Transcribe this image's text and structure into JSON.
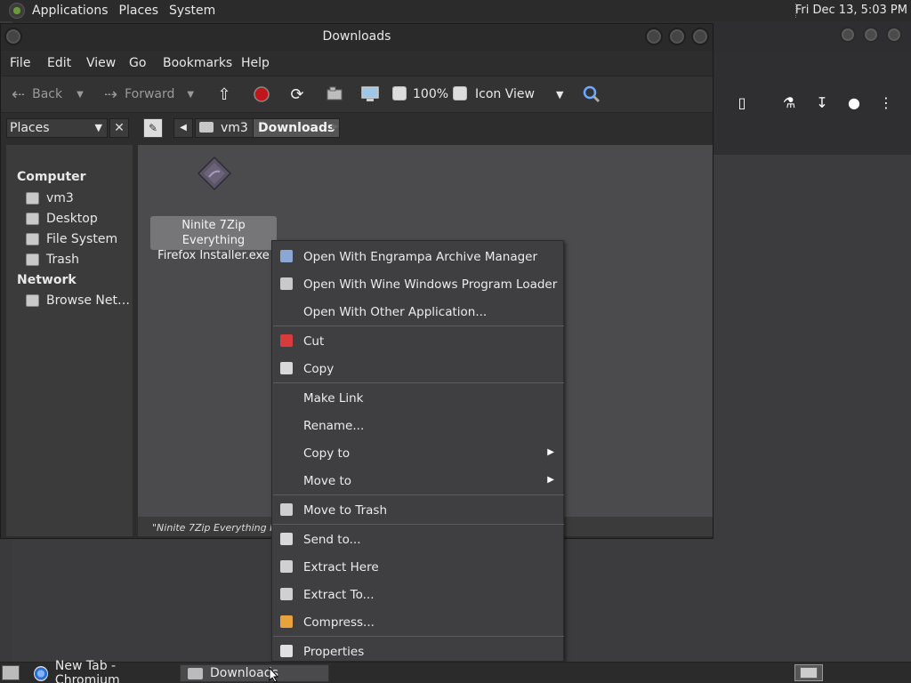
{
  "top_panel": {
    "menus": [
      "Applications",
      "Places",
      "System"
    ],
    "clock": "Fri Dec 13,  5:03 PM"
  },
  "window": {
    "title": "Downloads",
    "menubar": [
      "File",
      "Edit",
      "View",
      "Go",
      "Bookmarks",
      "Help"
    ]
  },
  "toolbar": {
    "back_label": "Back",
    "forward_label": "Forward",
    "zoom": "100%",
    "view_mode": "Icon View"
  },
  "location": {
    "sidebar_select": "Places",
    "crumbs": [
      "vm3",
      "Downloads"
    ]
  },
  "sidebar": {
    "sections": [
      {
        "title": "Computer",
        "items": [
          {
            "label": "vm3",
            "icon": "home-folder-icon"
          },
          {
            "label": "Desktop",
            "icon": "desktop-folder-icon"
          },
          {
            "label": "File System",
            "icon": "drive-icon"
          },
          {
            "label": "Trash",
            "icon": "trash-icon"
          }
        ]
      },
      {
        "title": "Network",
        "items": [
          {
            "label": "Browse Net…",
            "icon": "network-icon"
          }
        ]
      }
    ]
  },
  "file": {
    "label_line1": "Ninite 7Zip Everything",
    "label_line2": "Firefox Installer.exe",
    "icon": "wine-diamond-icon"
  },
  "status_text": "\"Ninite 7Zip Everything Firefox Installer.exe\" selected",
  "context_menu": {
    "groups": [
      [
        {
          "label": "Open With Engrampa Archive Manager",
          "icon": "archive-manager-icon"
        },
        {
          "label": "Open With Wine Windows Program Loader",
          "icon": "wine-icon"
        },
        {
          "label": "Open With Other Application...",
          "icon": ""
        }
      ],
      [
        {
          "label": "Cut",
          "icon": "scissors-icon"
        },
        {
          "label": "Copy",
          "icon": "copy-icon"
        }
      ],
      [
        {
          "label": "Make Link",
          "icon": ""
        },
        {
          "label": "Rename...",
          "icon": ""
        },
        {
          "label": "Copy to",
          "icon": "",
          "submenu": true
        },
        {
          "label": "Move to",
          "icon": "",
          "submenu": true
        }
      ],
      [
        {
          "label": "Move to Trash",
          "icon": "trash-icon"
        }
      ],
      [
        {
          "label": "Send to...",
          "icon": "send-icon"
        },
        {
          "label": "Extract Here",
          "icon": "extract-icon"
        },
        {
          "label": "Extract To...",
          "icon": "extract-to-icon"
        },
        {
          "label": "Compress...",
          "icon": "compress-icon"
        }
      ],
      [
        {
          "label": "Properties",
          "icon": "properties-icon"
        }
      ]
    ]
  },
  "taskbar": {
    "tasks": [
      {
        "label": "New Tab - Chromium",
        "icon": "chromium-icon"
      },
      {
        "label": "Downloads",
        "icon": "folder-icon"
      }
    ]
  },
  "colors": {
    "panel": "#2b2b2b",
    "window": "#2d2d2d",
    "icon_area": "#4b4b4d",
    "menu": "#3f3f41",
    "accent_search": "#6fa8ff",
    "record": "#c0161b"
  }
}
